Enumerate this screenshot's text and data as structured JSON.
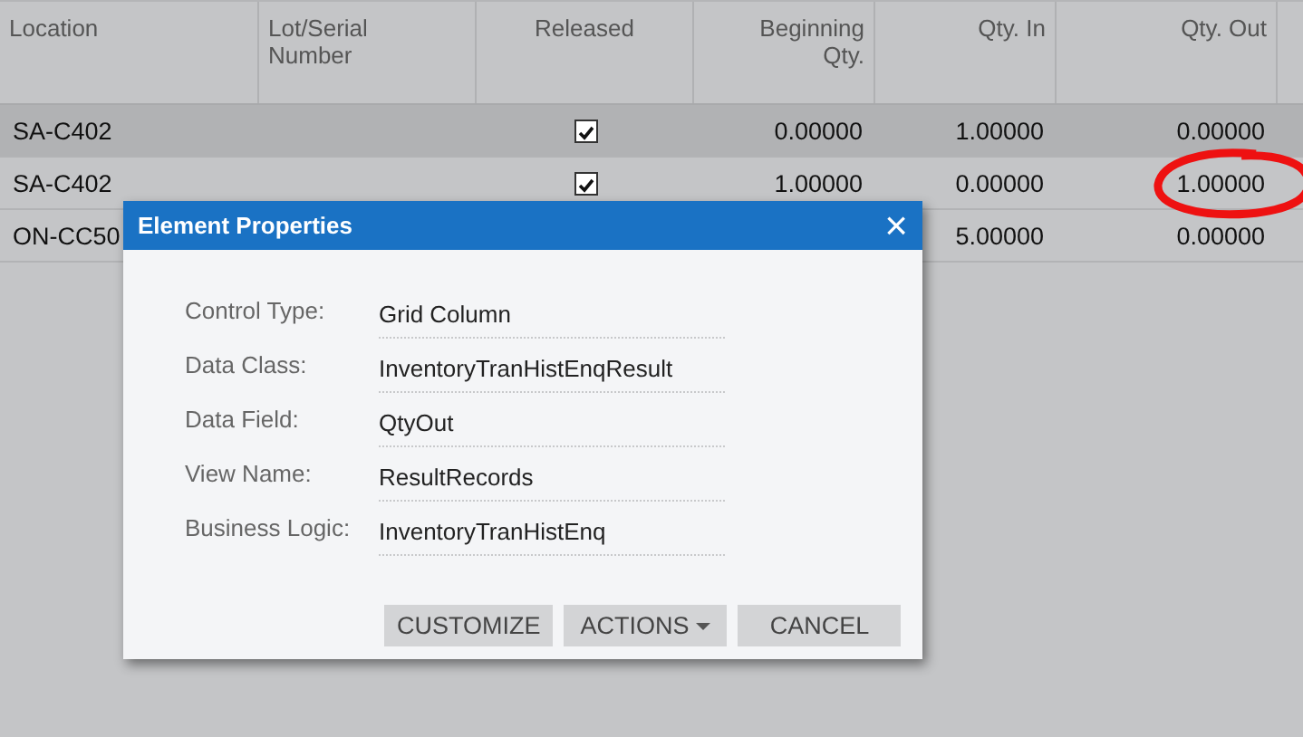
{
  "grid": {
    "columns": [
      {
        "label": "Location"
      },
      {
        "label": "Lot/Serial Number"
      },
      {
        "label": "Released"
      },
      {
        "label": "Beginning Qty."
      },
      {
        "label": "Qty. In"
      },
      {
        "label": "Qty. Out"
      }
    ],
    "rows": [
      {
        "selected": true,
        "location": "SA-C402",
        "released": true,
        "beginning_qty": "0.00000",
        "qty_in": "1.00000",
        "qty_out": "0.00000",
        "circled": false
      },
      {
        "selected": false,
        "location": "SA-C402",
        "released": true,
        "beginning_qty": "1.00000",
        "qty_in": "0.00000",
        "qty_out": "1.00000",
        "circled": true
      },
      {
        "selected": false,
        "location": "ON-CC50",
        "qty_in": "5.00000",
        "qty_out": "0.00000",
        "circled": false
      }
    ]
  },
  "dialog": {
    "title": "Element Properties",
    "close": "×",
    "properties": [
      {
        "label": "Control Type:",
        "value": "Grid Column"
      },
      {
        "label": "Data Class:",
        "value": "InventoryTranHistEnqResult"
      },
      {
        "label": "Data Field:",
        "value": "QtyOut"
      },
      {
        "label": "View Name:",
        "value": "ResultRecords"
      },
      {
        "label": "Business Logic:",
        "value": "InventoryTranHistEnq"
      }
    ],
    "buttons": [
      {
        "label": "CUSTOMIZE",
        "dropdown": false
      },
      {
        "label": "ACTIONS",
        "dropdown": true
      },
      {
        "label": "CANCEL",
        "dropdown": false
      }
    ]
  }
}
